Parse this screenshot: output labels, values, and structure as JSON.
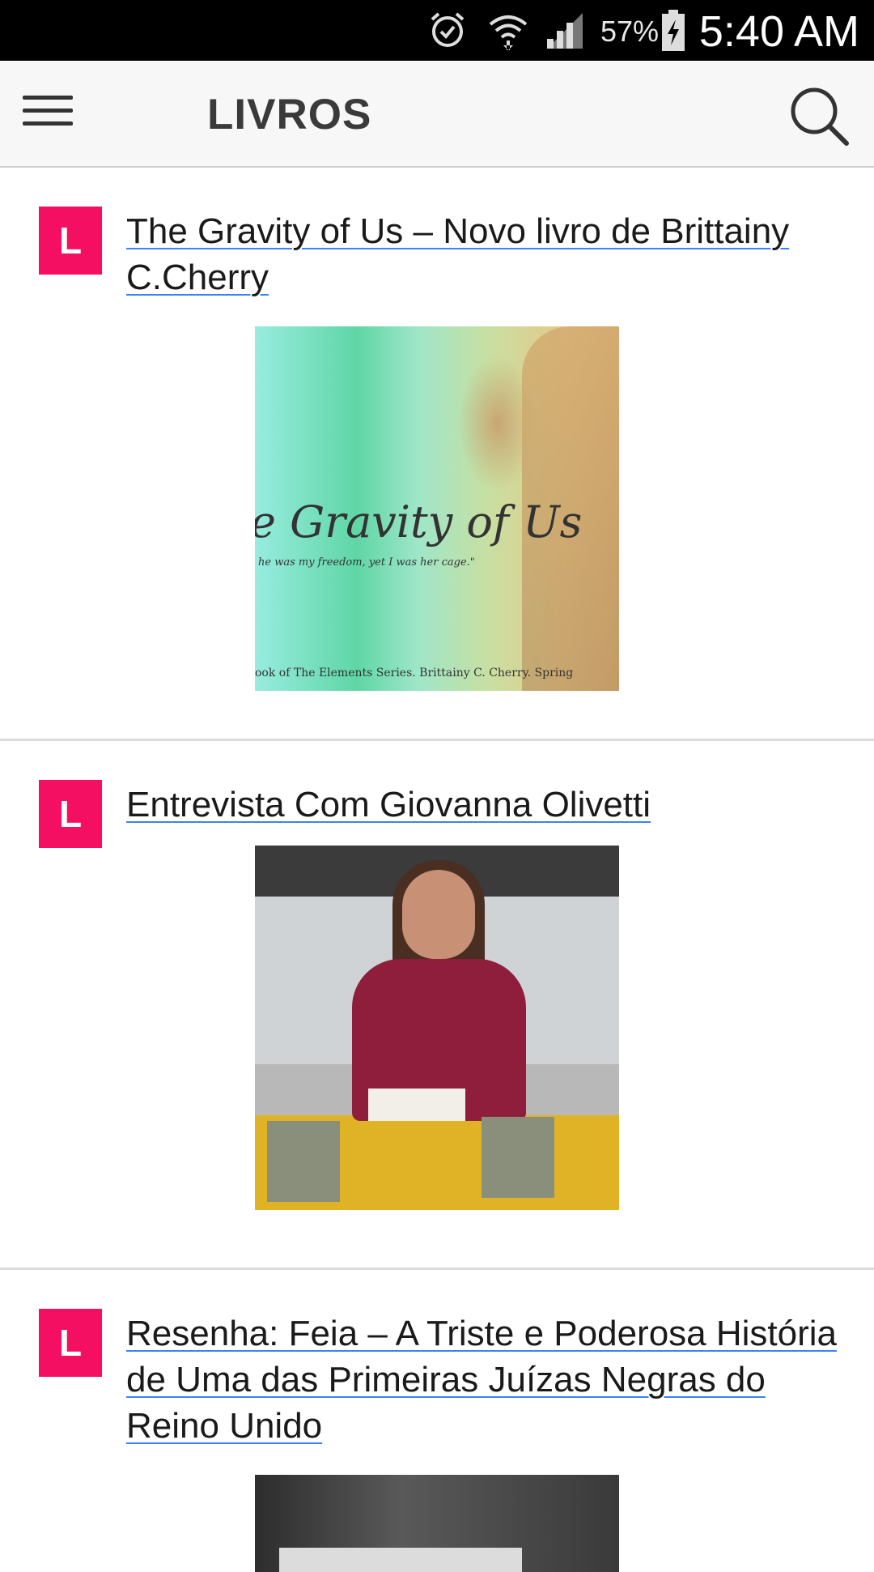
{
  "status_bar": {
    "battery_percent": "57%",
    "time": "5:40 AM",
    "icons": [
      "alarm-icon",
      "wifi-icon",
      "signal-icon",
      "battery-charging-icon"
    ]
  },
  "app_bar": {
    "title": "LIVROS",
    "menu_icon": "hamburger-menu-icon",
    "search_icon": "search-icon"
  },
  "posts": [
    {
      "badge": "L",
      "title": "The Gravity of Us – Novo livro de Brittainy C.Cherry",
      "image": {
        "heading": "e Gravity of Us",
        "tagline": "he was my freedom, yet I was her cage.\"",
        "footer": "ook of The Elements Series. Brittainy C. Cherry. Spring"
      }
    },
    {
      "badge": "L",
      "title": "Entrevista Com Giovanna Olivetti"
    },
    {
      "badge": "L",
      "title": "Resenha: Feia – A Triste e Poderosa História de Uma das Primeiras Juízas Negras do Reino Unido"
    }
  ],
  "colors": {
    "badge": "#f50f63",
    "link_underline": "#3b82f6",
    "app_bar_bg": "#f7f7f7",
    "status_bar_bg": "#000000"
  }
}
